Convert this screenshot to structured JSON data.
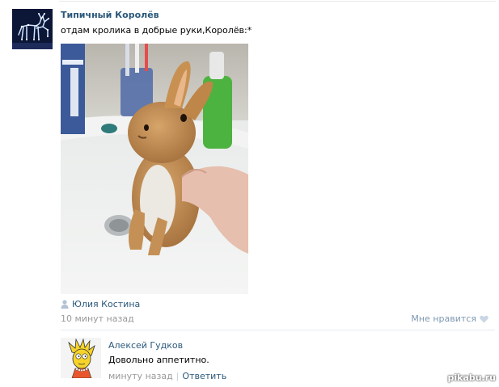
{
  "post": {
    "author": "Типичный Королёв",
    "text": "отдам кролика в добрые руки,Королёв:*",
    "photo_owner": "Юлия Костина",
    "time": "10 минут назад",
    "like_label": "Мне нравится"
  },
  "comment": {
    "author": "Алексей Гудков",
    "text": "Довольно аппетитно.",
    "time": "минуту назад",
    "separator": "|",
    "reply_label": "Ответить"
  },
  "watermark": "pikabu.ru",
  "colors": {
    "link": "#2b587a",
    "muted": "#999999",
    "like": "#7e98b1",
    "divider": "#e7eaed"
  },
  "icons": {
    "owner": "person-icon",
    "like": "heart-icon"
  }
}
